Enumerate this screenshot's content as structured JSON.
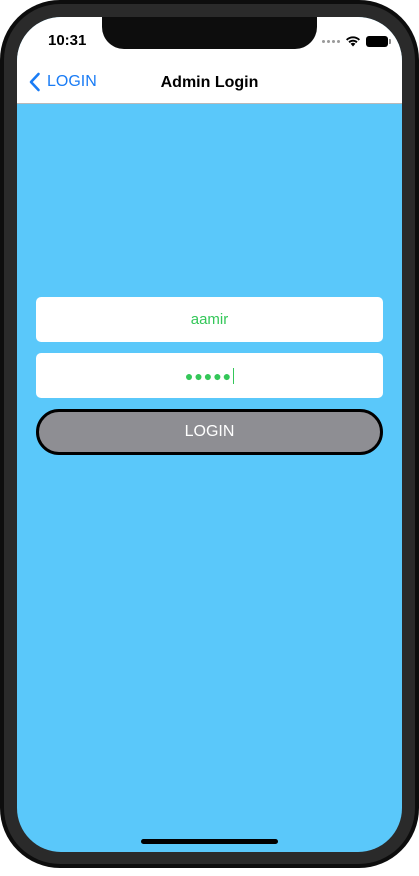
{
  "status_bar": {
    "time": "10:31",
    "icons": [
      "signal-icon",
      "wifi-icon",
      "battery-icon"
    ]
  },
  "nav_bar": {
    "back_label": "LOGIN",
    "title": "Admin Login"
  },
  "form": {
    "username_value": "aamir",
    "password_masked": "●●●●●",
    "login_label": "LOGIN"
  },
  "colors": {
    "screen_background": "#5ac8fa",
    "accent_link": "#1a7cf5",
    "input_text": "#34c759",
    "button_fill": "#8e8e93",
    "button_border": "#000000"
  }
}
